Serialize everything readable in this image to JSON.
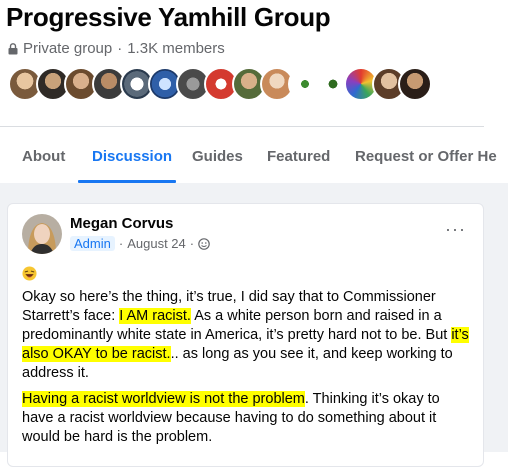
{
  "group": {
    "name": "Progressive Yamhill Group",
    "privacy": "Private group",
    "separator": "·",
    "members": "1.3K members"
  },
  "tabs": [
    {
      "label": "About"
    },
    {
      "label": "Discussion",
      "active": true
    },
    {
      "label": "Guides"
    },
    {
      "label": "Featured"
    },
    {
      "label": "Request or Offer He"
    }
  ],
  "post": {
    "author": "Megan Corvus",
    "role": "Admin",
    "separator": "·",
    "date": "August 24",
    "separator2": "·",
    "more_label": "···",
    "paragraph1": {
      "t1": "Okay so here’s the thing, it’s true, I did say that to Commissioner Starrett’s face: ",
      "h1": "I AM racist.",
      "t2": "  As a white person born and raised in a predominantly white state in America, it’s pretty hard not to be.  But ",
      "h2": "it’s also OKAY to be racist.",
      "t3": ".. as long as you see it, and keep working to address it."
    },
    "paragraph2": {
      "h1": "Having a racist worldview is not the problem",
      "t1": ".  Thinking it’s okay to have a racist worldview because having to do something about it would be hard is the problem."
    }
  },
  "colors": {
    "accent": "#1877f2",
    "highlight": "#ffff00",
    "feed_background": "#f0f2f5",
    "secondary_text": "#65676b"
  }
}
